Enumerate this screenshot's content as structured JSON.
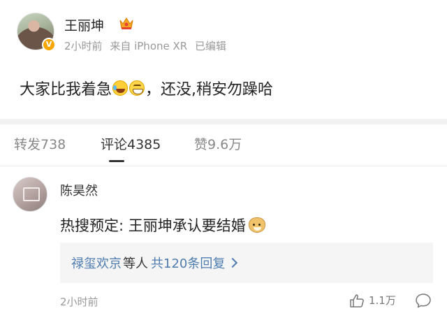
{
  "post": {
    "username": "王丽坤",
    "time": "2小时前",
    "source": "来自 iPhone XR",
    "edited": "已编辑",
    "text_before": "大家比我着急",
    "text_after": "，还没,稍安勿躁哈",
    "emojis": [
      "laugh-cry-emoji",
      "grin-emoji"
    ],
    "verified_icon": "verified-badge-icon",
    "accent": "#f7a600"
  },
  "tabs": [
    {
      "label": "转发738"
    },
    {
      "label": "评论4385"
    },
    {
      "label": "赞9.6万"
    }
  ],
  "comment": {
    "username": "陈昊然",
    "text": "热搜预定: 王丽坤承认要结婚",
    "emoji": "doge-emoji",
    "reply": {
      "user": "禄玺欢京",
      "mid": "等人",
      "count": "共120条回复"
    },
    "time": "2小时前",
    "likes": "1.1万"
  },
  "colors": {
    "link": "#4e7cb0",
    "muted": "#999999",
    "text": "#333333"
  }
}
